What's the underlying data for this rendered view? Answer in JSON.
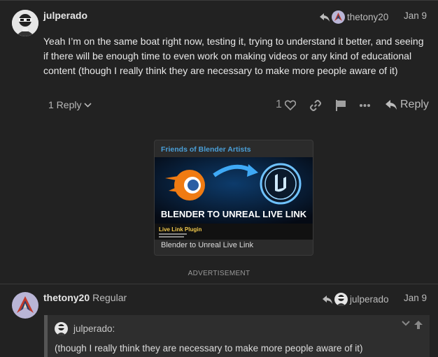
{
  "post1": {
    "username": "julperado",
    "reply_to_user": "thetony20",
    "date": "Jan 9",
    "body": "Yeah I’m on the same boat right now, testing it, trying to understand it better, and seeing if there will be enough time to even work on making videos or any kind of educational content (though I really think they are necessary to make more people aware of it)",
    "replies_label": "1 Reply",
    "like_count": "1",
    "reply_label": "Reply"
  },
  "onebox": {
    "source": "Friends of Blender Artists",
    "image_caption": "BLENDER TO UNREAL LIVE LINK",
    "image_subcaption": "Live Link Plugin",
    "title": "Blender to Unreal Live Link"
  },
  "ad_label": "ADVERTISEMENT",
  "post2": {
    "username": "thetony20",
    "user_title": "Regular",
    "reply_to_user": "julperado",
    "date": "Jan 9",
    "quote_user": "julperado:",
    "quote_text": "(though I really think they are necessary to make more people aware of it)"
  },
  "colors": {
    "background": "#222222",
    "link_blue": "#4a9fd8",
    "text": "#dddddd",
    "muted": "#a0a0a0"
  },
  "icons": [
    "reply-arrow-icon",
    "chevron-down-icon",
    "heart-icon",
    "link-icon",
    "flag-icon",
    "ellipsis-icon",
    "reply-icon",
    "chevron-up-icon"
  ]
}
